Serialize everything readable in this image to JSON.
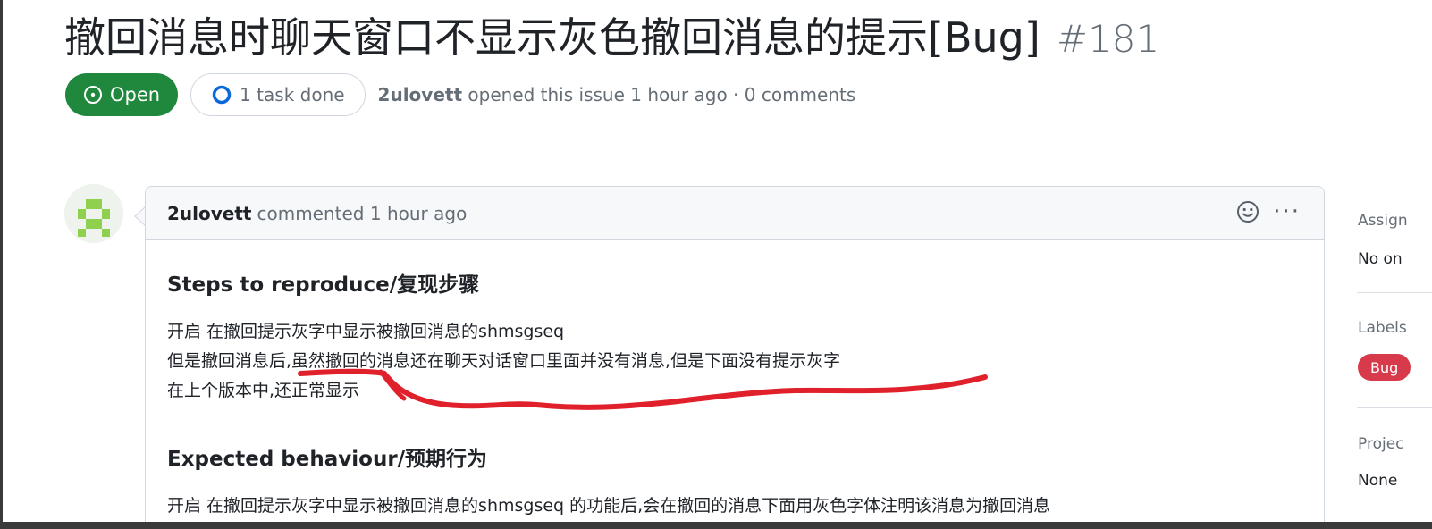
{
  "issue": {
    "title": "撤回消息时聊天窗口不显示灰色撤回消息的提示[Bug]",
    "number": "#181",
    "state": "Open",
    "tasks": "1 task done",
    "author": "2ulovett",
    "meta_rest": "opened this issue 1 hour ago · 0 comments"
  },
  "comment": {
    "author": "2ulovett",
    "action": "commented 1 hour ago",
    "menu_glyph": "···",
    "sections": [
      {
        "heading": "Steps to reproduce/复现步骤",
        "lines": [
          "开启 在撤回提示灰字中显示被撤回消息的shmsgseq",
          "但是撤回消息后,虽然撤回的消息还在聊天对话窗口里面并没有消息,但是下面没有提示灰字",
          "在上个版本中,还正常显示"
        ]
      },
      {
        "heading": "Expected behaviour/预期行为",
        "lines": [
          "开启 在撤回提示灰字中显示被撤回消息的shmsgseq 的功能后,会在撤回的消息下面用灰色字体注明该消息为撤回消息"
        ]
      }
    ]
  },
  "sidebar": {
    "assignees_label": "Assign",
    "assignees_value": "No on",
    "labels_label": "Labels",
    "label_bug": "Bug",
    "projects_label": "Projec",
    "projects_value": "None"
  },
  "colors": {
    "open_green": "#1f883d",
    "bug_red": "#d73a4a",
    "annotation_red": "#e0202a",
    "avatar_green": "#8fd14f"
  },
  "icons": [
    "issue-open-icon",
    "task-progress-icon",
    "avatar-identicon",
    "smiley-icon",
    "kebab-icon"
  ]
}
